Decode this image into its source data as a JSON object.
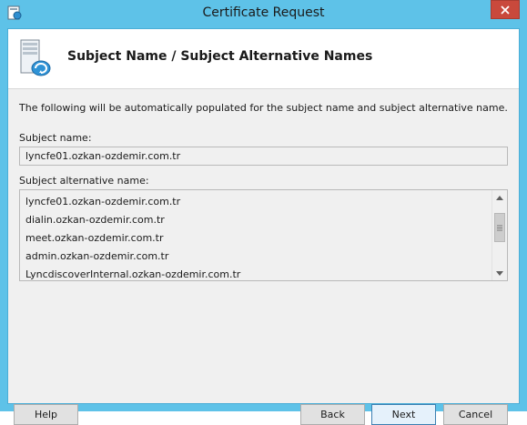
{
  "window": {
    "title": "Certificate Request",
    "close_glyph": "✕"
  },
  "header": {
    "title": "Subject Name / Subject Alternative Names",
    "icon": "server-certificate-icon"
  },
  "body": {
    "description": "The following will be automatically populated for the subject name and subject alternative name.",
    "subject_name_label": "Subject name:",
    "subject_name_value": "lyncfe01.ozkan-ozdemir.com.tr",
    "san_label": "Subject alternative name:",
    "san_items": [
      "lyncfe01.ozkan-ozdemir.com.tr",
      "dialin.ozkan-ozdemir.com.tr",
      "meet.ozkan-ozdemir.com.tr",
      "admin.ozkan-ozdemir.com.tr",
      "LyncdiscoverInternal.ozkan-ozdemir.com.tr"
    ]
  },
  "buttons": {
    "help": "Help",
    "back": "Back",
    "next": "Next",
    "cancel": "Cancel"
  },
  "colors": {
    "frame": "#5ec2e8",
    "close": "#c9493c",
    "client_bg": "#f0f0f0",
    "accent_border": "#3c7fb1"
  }
}
